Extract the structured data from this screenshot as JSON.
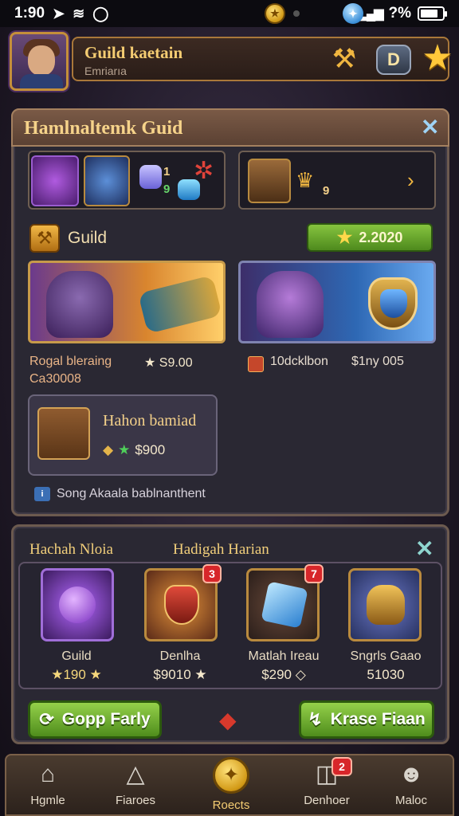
{
  "status_bar": {
    "time": "1:90",
    "battery_text": "?%"
  },
  "header": {
    "title": "Guild kaetain",
    "subtitle": "Emriarıa",
    "d_button_label": "D"
  },
  "guild_panel": {
    "title": "Hamlnaltemk Guid",
    "top_slots": {
      "left_count_a": "1",
      "left_count_b": "9",
      "right_count": "9"
    },
    "guild_label": "Guild",
    "guild_price": "2.2020",
    "card_a": {
      "title_line1": "Rogal bleraing",
      "title_line2": "Ca30008",
      "price": "★ S9.00"
    },
    "card_b": {
      "title": "10dcklbon",
      "price": "$1ny 005"
    },
    "chest": {
      "title": "Hahon bamiad",
      "price": "$900"
    },
    "footer_note": "Song Akaala bablnanthent"
  },
  "gift_panel": {
    "heading_left": "Hachah Nloia",
    "heading_center": "Hadigah Harian",
    "items": [
      {
        "name": "Guild",
        "price": "★190 ★",
        "badge": ""
      },
      {
        "name": "Denlha",
        "price": "$9010 ★",
        "badge": "3"
      },
      {
        "name": "Matlah Ireau",
        "price": "$290 ◇",
        "badge": "7"
      },
      {
        "name": "Sngrls Gaao",
        "price": "51030",
        "badge": ""
      }
    ],
    "left_button": "Gopp Farly",
    "right_button": "Krase Fiaan"
  },
  "bottom_nav": {
    "items": [
      {
        "label": "Hgmle"
      },
      {
        "label": "Fiaroes"
      },
      {
        "label": "Roects"
      },
      {
        "label": "Denhoer",
        "badge": "2"
      },
      {
        "label": "Maloc"
      }
    ]
  },
  "colors": {
    "accent_gold": "#f4cc72",
    "button_green": "#4f8d1c",
    "badge_red": "#d7262a",
    "panel_bg": "#2a2833"
  }
}
